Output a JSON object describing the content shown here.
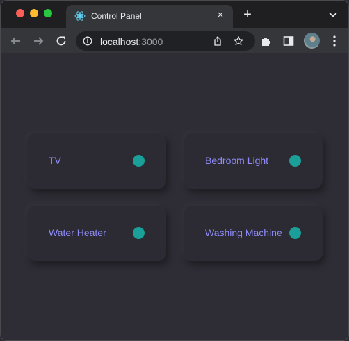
{
  "browser": {
    "tab_title": "Control Panel",
    "close_glyph": "×",
    "new_tab_glyph": "+",
    "url_host": "localhost",
    "url_port": ":3000",
    "icons": [
      "react-icon",
      "close-icon",
      "plus-icon",
      "chevron-down-icon",
      "back-icon",
      "forward-icon",
      "reload-icon",
      "info-icon",
      "share-icon",
      "star-icon",
      "extensions-icon",
      "sidebar-icon",
      "more-icon"
    ]
  },
  "devices": [
    {
      "label": "TV",
      "status": "on"
    },
    {
      "label": "Bedroom Light",
      "status": "on"
    },
    {
      "label": "Water Heater",
      "status": "on"
    },
    {
      "label": "Washing Machine",
      "status": "on"
    }
  ],
  "colors": {
    "background": "#2e2d35",
    "card": "#2c2b33",
    "label": "#8f8cf7",
    "indicator_on": "#1a9f99"
  }
}
